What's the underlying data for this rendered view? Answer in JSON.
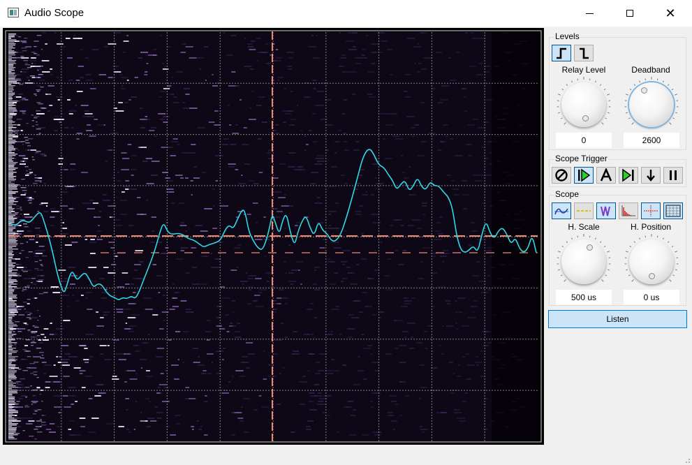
{
  "window": {
    "title": "Audio Scope"
  },
  "levels": {
    "title": "Levels",
    "buttons": [
      {
        "name": "rising-edge",
        "icon": "rising-edge-icon",
        "active": true
      },
      {
        "name": "falling-edge",
        "icon": "falling-edge-icon",
        "active": false
      }
    ],
    "relay_level": {
      "label": "Relay Level",
      "value": "0",
      "knob_fraction": 0.5
    },
    "deadband": {
      "label": "Deadband",
      "value": "2600",
      "knob_fraction": 0.0
    }
  },
  "scope_trigger": {
    "title": "Scope Trigger",
    "buttons": [
      {
        "name": "trigger-off",
        "icon": "no-symbol-icon",
        "active": false
      },
      {
        "name": "trigger-normal",
        "icon": "play-bar-icon",
        "active": true
      },
      {
        "name": "trigger-auto",
        "icon": "letter-a-icon",
        "active": false
      },
      {
        "name": "trigger-single",
        "icon": "play-end-icon",
        "active": false
      },
      {
        "name": "trigger-down",
        "icon": "arrow-down-icon",
        "active": false
      },
      {
        "name": "trigger-pause",
        "icon": "pause-icon",
        "active": false
      }
    ]
  },
  "scope": {
    "title": "Scope",
    "buttons": [
      {
        "name": "waveform-mode",
        "icon": "waveform-icon",
        "active": true
      },
      {
        "name": "trigger-line-mode",
        "icon": "trigger-line-icon",
        "active": false
      },
      {
        "name": "waterfall-mode",
        "icon": "waterfall-icon",
        "active": true
      },
      {
        "name": "spectrum-mode",
        "icon": "spectrum-icon",
        "active": false
      },
      {
        "name": "crosshair-mode",
        "icon": "crosshair-icon",
        "active": true
      },
      {
        "name": "grid-mode",
        "icon": "grid-icon",
        "active": true
      }
    ],
    "h_scale": {
      "label": "H. Scale",
      "value": "500 us"
    },
    "h_position": {
      "label": "H. Position",
      "value": "0 us"
    }
  },
  "listen_label": "Listen",
  "colors": {
    "trace": "#2fd8e6",
    "trigger_line": "#f08a74",
    "grid": "#9a9a9a",
    "accent": "#0078d7",
    "button_on": "#cce4f7"
  }
}
